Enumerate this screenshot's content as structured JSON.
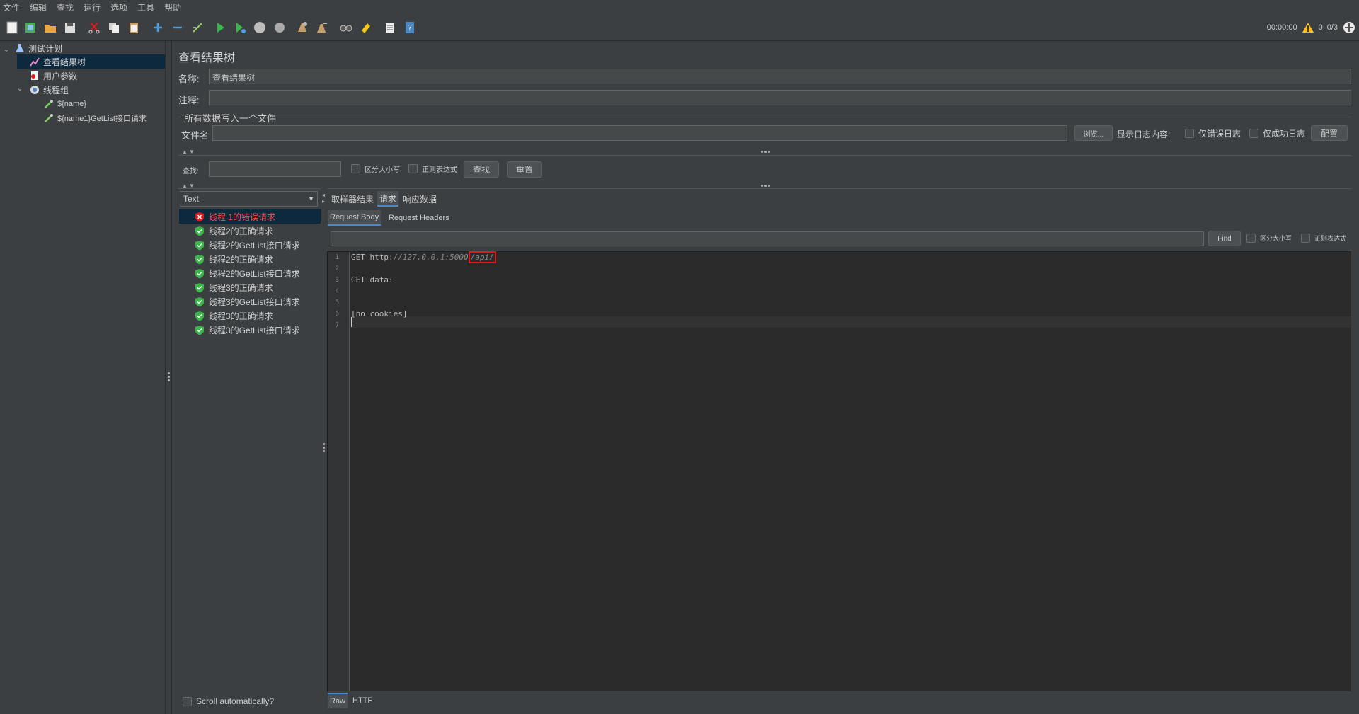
{
  "menu": [
    "文件",
    "编辑",
    "查找",
    "运行",
    "选项",
    "工具",
    "帮助"
  ],
  "toolbar": {
    "timer": "00:00:00",
    "warnings": "0",
    "threads": "0/3"
  },
  "tree": {
    "items": [
      {
        "label": "测试计划",
        "icon": "flask-icon"
      },
      {
        "label": "查看结果树",
        "icon": "chart-icon"
      },
      {
        "label": "用户参数",
        "icon": "params-icon"
      },
      {
        "label": "线程组",
        "icon": "gear-icon"
      },
      {
        "label": "${name}",
        "icon": "pipette-icon"
      },
      {
        "label": "${name1}GetList接口请求",
        "icon": "pipette-icon"
      }
    ]
  },
  "panel": {
    "title": "查看结果树",
    "name_label": "名称:",
    "name_value": "查看结果树",
    "comment_label": "注释:",
    "comment_value": "",
    "file_group_label": "所有数据写入一个文件",
    "filename_label": "文件名",
    "filename_value": "",
    "browse_button": "浏览...",
    "log_label": "显示日志内容:",
    "errors_only": "仅错误日志",
    "success_only": "仅成功日志",
    "config_button": "配置",
    "search_label": "查找:",
    "search_value": "",
    "case_sensitive": "区分大小写",
    "regex": "正则表达式",
    "find_button": "查找",
    "reset_button": "重置"
  },
  "renderer": {
    "selected": "Text"
  },
  "results": [
    {
      "label": "线程 1的错误请求",
      "status": "error"
    },
    {
      "label": "线程2的正确请求",
      "status": "ok"
    },
    {
      "label": "线程2的GetList接口请求",
      "status": "ok"
    },
    {
      "label": "线程2的正确请求",
      "status": "ok"
    },
    {
      "label": "线程2的GetList接口请求",
      "status": "ok"
    },
    {
      "label": "线程3的正确请求",
      "status": "ok"
    },
    {
      "label": "线程3的GetList接口请求",
      "status": "ok"
    },
    {
      "label": "线程3的正确请求",
      "status": "ok"
    },
    {
      "label": "线程3的GetList接口请求",
      "status": "ok"
    }
  ],
  "scroll_auto": "Scroll automatically?",
  "detail": {
    "tabs": [
      "取样器结果",
      "请求",
      "响应数据"
    ],
    "active_tab": "请求",
    "subtabs": [
      "Request Body",
      "Request Headers"
    ],
    "find_button": "Find",
    "find_case": "区分大小写",
    "find_regex": "正则表达式",
    "bottom_tabs": [
      "Raw",
      "HTTP"
    ],
    "lines": [
      "1",
      "2",
      "3",
      "4",
      "5",
      "6",
      "7"
    ],
    "code": {
      "method": "GET ",
      "scheme": "http:",
      "host": "//127.0.0.1:5000",
      "path": "/api/",
      "data_line": "GET data:",
      "cookies_line": "[no cookies]"
    }
  },
  "colors": {
    "background": "#3c3f41",
    "editor": "#2b2b2b",
    "selection": "#0d293e",
    "error": "#e0191b",
    "ok": "#3cb54a",
    "accent": "#4a88c7"
  }
}
